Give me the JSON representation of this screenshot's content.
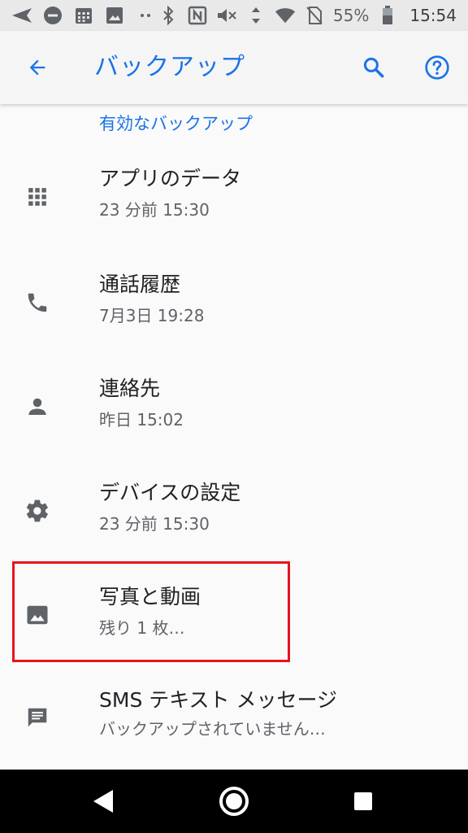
{
  "status_bar": {
    "battery": "55%",
    "time": "15:54",
    "icons": [
      "send-icon",
      "do-not-disturb-icon",
      "calendar-icon",
      "image-icon",
      "more-dots-icon",
      "bluetooth-icon",
      "nfc-icon",
      "mute-icon",
      "data-arrows-icon",
      "wifi-icon",
      "no-sim-icon",
      "battery-icon"
    ]
  },
  "app_bar": {
    "title": "バックアップ",
    "back_icon": "arrow-back-icon",
    "search_icon": "search-icon",
    "help_icon": "help-icon"
  },
  "section": {
    "header": "有効なバックアップ"
  },
  "items": [
    {
      "title": "アプリのデータ",
      "subtitle": "23 分前 15:30",
      "icon": "apps-grid-icon"
    },
    {
      "title": "通話履歴",
      "subtitle": "7月3日 19:28",
      "icon": "phone-icon"
    },
    {
      "title": "連絡先",
      "subtitle": "昨日 15:02",
      "icon": "person-icon"
    },
    {
      "title": "デバイスの設定",
      "subtitle": "23 分前 15:30",
      "icon": "gear-icon"
    },
    {
      "title": "写真と動画",
      "subtitle": "残り 1 枚…",
      "icon": "photo-icon"
    },
    {
      "title": "SMS テキスト メッセージ",
      "subtitle": "バックアップされていません…",
      "icon": "message-icon"
    }
  ],
  "colors": {
    "accent": "#1a73e8",
    "highlight": "#e8141c",
    "icon": "#5f6368"
  },
  "nav_bar": {
    "icons": [
      "back-triangle-icon",
      "home-circle-icon",
      "recents-square-icon"
    ]
  }
}
